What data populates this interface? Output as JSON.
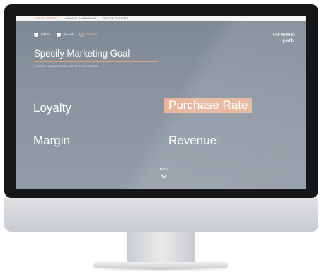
{
  "nav": {
    "items": [
      "Create Target",
      "Manage Calendars",
      "Review Reports"
    ],
    "active_index": 0
  },
  "steps": [
    {
      "label": "Dates",
      "state": "done"
    },
    {
      "label": "Goals",
      "state": "done"
    },
    {
      "label": "Target",
      "state": "current"
    }
  ],
  "brand": {
    "line1": "coherent",
    "line2": "path"
  },
  "heading": "Specify Marketing Goal",
  "subheading": "Choose a business goal to optimize around",
  "goals": [
    {
      "label": "Loyalty",
      "selected": false
    },
    {
      "label": "Purchase Rate",
      "selected": true
    },
    {
      "label": "Margin",
      "selected": false
    },
    {
      "label": "Revenue",
      "selected": false
    }
  ],
  "next_label": "next",
  "colors": {
    "accent": "#e6b49a",
    "screen_bg": "#85909b",
    "bezel": "#161718"
  }
}
